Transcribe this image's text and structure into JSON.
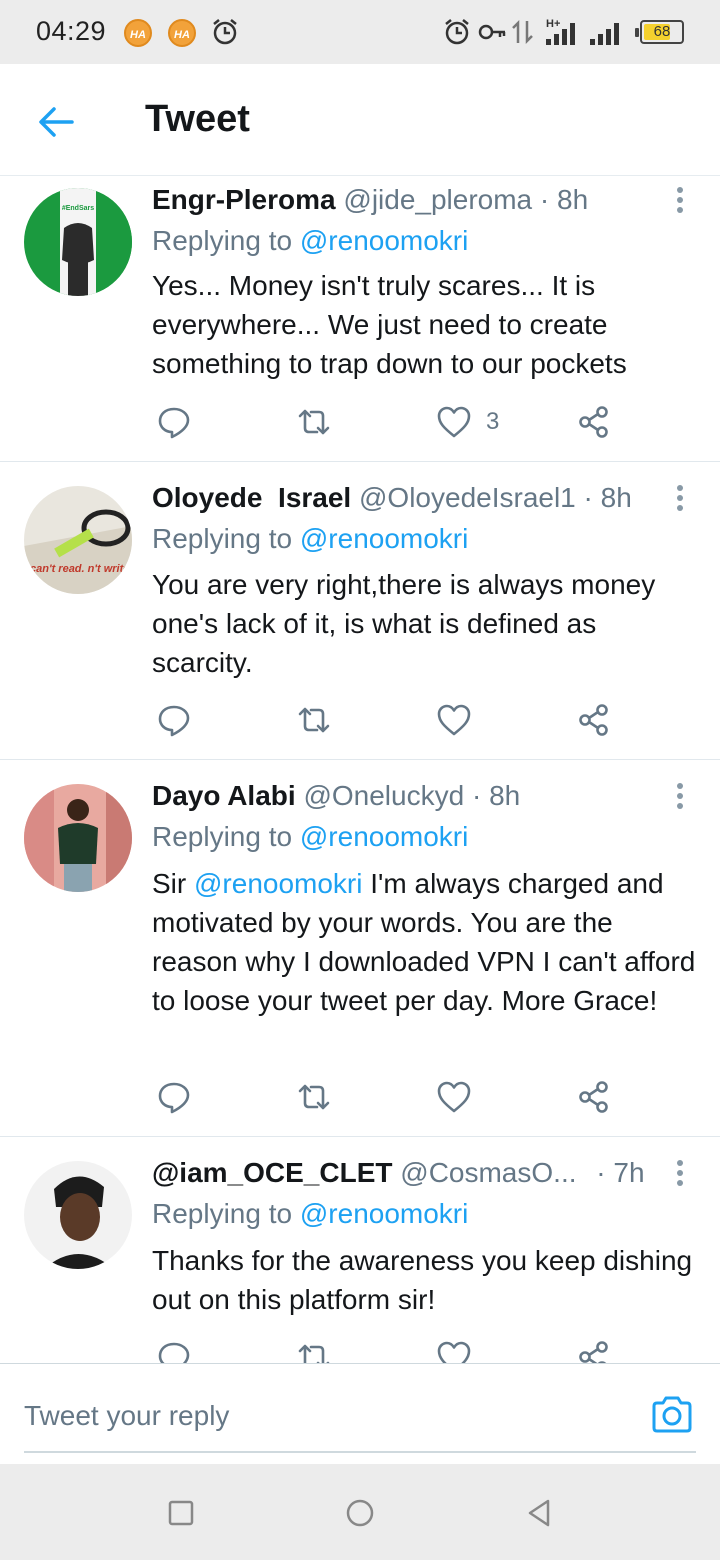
{
  "status_bar": {
    "time": "04:29",
    "battery": "68",
    "badge_text": "HA"
  },
  "header": {
    "title": "Tweet"
  },
  "tweets": [
    {
      "name": "Engr-Pleroma",
      "handle": "@jide_pleroma",
      "age": "8h",
      "replying_prefix": "Replying to",
      "replying_to": "@renoomokri",
      "text": "Yes...  Money isn't truly scares... It is everywhere... We just need to create something to trap down to our pockets",
      "likes": "3"
    },
    {
      "name": "Oloyede  Israel",
      "handle": "@OloyedeIsrael1",
      "age": "8h",
      "replying_prefix": "Replying to",
      "replying_to": "@renoomokri",
      "text": "You are very right,there is always money one's lack of it, is what is defined as scarcity.",
      "likes": "",
      "avatar_text": "can't read. n't write."
    },
    {
      "name": "Dayo Alabi",
      "handle": "@Oneluckyd",
      "age": "8h",
      "replying_prefix": "Replying to",
      "replying_to": "@renoomokri",
      "text_prefix": "Sir ",
      "text_mention": "@renoomokri",
      "text_rest": " I'm always charged and motivated by your words. You are the reason why I downloaded VPN I can't afford to loose your tweet per day. More Grace!",
      "likes": ""
    },
    {
      "name": "@iam_OCE_CLET",
      "handle": "@CosmasO...",
      "age": "7h",
      "replying_prefix": "Replying to",
      "replying_to": "@renoomokri",
      "text": "Thanks for the awareness you keep dishing out on this platform sir!",
      "likes": ""
    }
  ],
  "reply_bar": {
    "placeholder": "Tweet your reply"
  },
  "colors": {
    "accent": "#1da1f2",
    "secondary_text": "#657786",
    "primary_text": "#14171a"
  },
  "icons": [
    "back-arrow-icon",
    "reply-icon",
    "retweet-icon",
    "like-icon",
    "share-icon",
    "more-icon",
    "camera-icon",
    "nav-recents-icon",
    "nav-home-icon",
    "nav-back-icon"
  ]
}
